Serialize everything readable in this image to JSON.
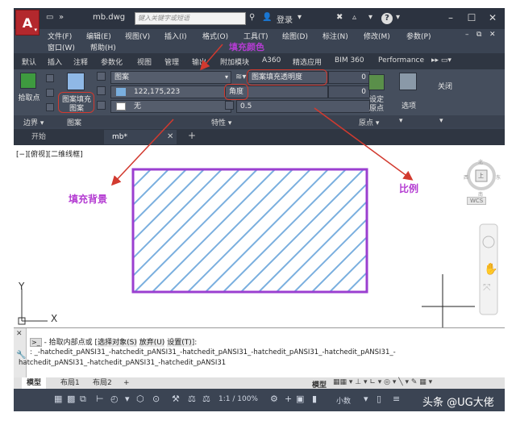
{
  "window": {
    "filename": "mb.dwg",
    "search_placeholder": "键入关键字或短语",
    "login_label": "登录",
    "help_label": "?"
  },
  "menu": [
    "文件(F)",
    "编辑(E)",
    "视图(V)",
    "插入(I)",
    "格式(O)",
    "工具(T)",
    "绘图(D)",
    "标注(N)",
    "修改(M)",
    "参数(P)",
    "窗口(W)",
    "帮助(H)"
  ],
  "ribbon_tabs": [
    "默认",
    "插入",
    "注释",
    "参数化",
    "视图",
    "管理",
    "输出",
    "附加模块",
    "A360",
    "精选应用",
    "BIM 360",
    "Performance"
  ],
  "ribbon": {
    "pick_point_label": "拾取点",
    "hatch_pattern_label_1": "图案填充",
    "hatch_pattern_label_2": "图案",
    "type_combo": "图案",
    "color_combo": "122,175,223",
    "bg_combo": "无",
    "transparency_label": "图案填充透明度",
    "transparency_value": "0",
    "angle_label": "角度",
    "angle_value": "0",
    "scale_value": "0.5",
    "set_origin_1": "设定",
    "set_origin_2": "原点",
    "options_label": "选项",
    "close_label": "关闭",
    "panel_boundary": "边界 ▾",
    "panel_pattern": "图案",
    "panel_properties": "特性 ▾",
    "panel_origin": "原点 ▾"
  },
  "doc_tabs": [
    "开始",
    "mb*"
  ],
  "view_label": "[−][俯视][二维线框]",
  "viewcube": {
    "north": "北",
    "south": "南",
    "east": "东",
    "west": "西",
    "top": "上",
    "wcs": "WCS"
  },
  "ucs": {
    "x": "X",
    "y": "Y"
  },
  "command": {
    "prompt_prefix": "- 拾取内部点或 [",
    "prompt_opt1": "选择对象(S)",
    "prompt_opt2": "放弃(U)",
    "prompt_opt3": "设置(T)",
    "prompt_suffix": "]:",
    "history_1": ": _-hatchedit_pANSI31_-hatchedit_pANSI31_-hatchedit_pANSI31_-hatchedit_pANSI31_-hatchedit_pANSI31_-",
    "history_2": "hatchedit_pANSI31_-hatchedit_pANSI31_-hatchedit_pANSI31"
  },
  "layout_tabs": [
    "模型",
    "布局1",
    "布局2"
  ],
  "status": {
    "model_label": "模型",
    "scale": "1:1 / 100%",
    "units": "小数"
  },
  "annotations": {
    "fill_color": "填充颜色",
    "fill_background": "填充背景",
    "scale": "比例",
    "watermark": "头条 @UG大佬"
  },
  "colors": {
    "hatch_line": "#7aafdf",
    "hatch_boundary": "#9b3fd0",
    "annotation_red": "#d23a2f",
    "annotation_purple": "#b43cd2",
    "app_red": "#b3282d"
  }
}
